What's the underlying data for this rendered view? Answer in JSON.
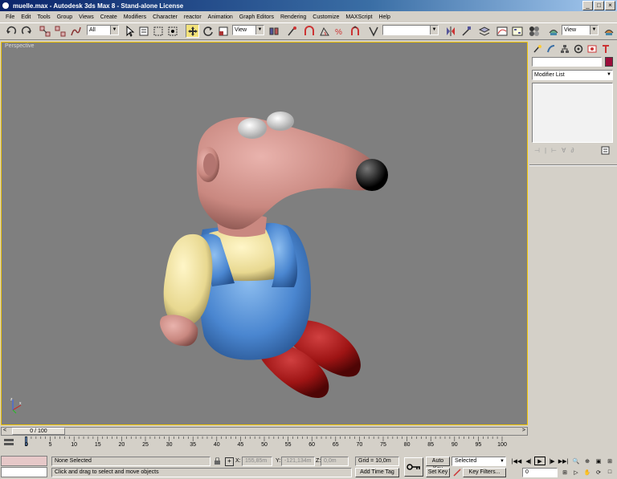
{
  "window": {
    "title": "muelle.max - Autodesk 3ds Max 8 - Stand-alone License"
  },
  "menu": [
    "File",
    "Edit",
    "Tools",
    "Group",
    "Views",
    "Create",
    "Modifiers",
    "Character",
    "reactor",
    "Animation",
    "Graph Editors",
    "Rendering",
    "Customize",
    "MAXScript",
    "Help"
  ],
  "toolbar": {
    "selection_filter": "All",
    "ref_coord": "View",
    "named_sel": "",
    "view_dropdown": "View"
  },
  "viewport": {
    "label": "Perspective"
  },
  "command_panel": {
    "modifier_list": "Modifier List"
  },
  "time_slider": {
    "position": "0 / 100"
  },
  "track_ticks": [
    "0",
    "5",
    "10",
    "15",
    "20",
    "25",
    "30",
    "35",
    "40",
    "45",
    "50",
    "55",
    "60",
    "65",
    "70",
    "75",
    "80",
    "85",
    "90",
    "95",
    "100"
  ],
  "status": {
    "selection": "None Selected",
    "prompt": "Click and drag to select and move objects",
    "x_label": "X:",
    "x_value": "155,85m",
    "y_label": "Y:",
    "y_value": "-121,134m",
    "z_label": "Z:",
    "z_value": "0,0m",
    "grid": "Grid = 10,0m",
    "add_time_tag": "Add Time Tag",
    "auto_key": "Auto Key",
    "set_key": "Set Key",
    "key_mode": "Selected",
    "key_filters": "Key Filters...",
    "frame": "0"
  },
  "colors": {
    "viewport_bg": "#7f7f7f",
    "viewport_border": "#f0c400",
    "ui_bg": "#d4d0c8",
    "swatch": "#9c0e3a"
  }
}
